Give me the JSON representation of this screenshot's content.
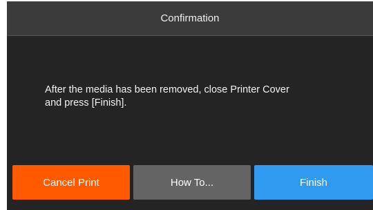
{
  "dialog": {
    "title": "Confirmation",
    "message_line1": "After the media has been removed, close Printer Cover",
    "message_line2": "and press [Finish]."
  },
  "buttons": {
    "cancel_label": "Cancel Print",
    "howto_label": "How To...",
    "finish_label": "Finish"
  },
  "colors": {
    "background": "#242424",
    "header": "#3b3b3b",
    "cancel": "#ff5a00",
    "howto": "#646464",
    "finish": "#2f9af0"
  }
}
